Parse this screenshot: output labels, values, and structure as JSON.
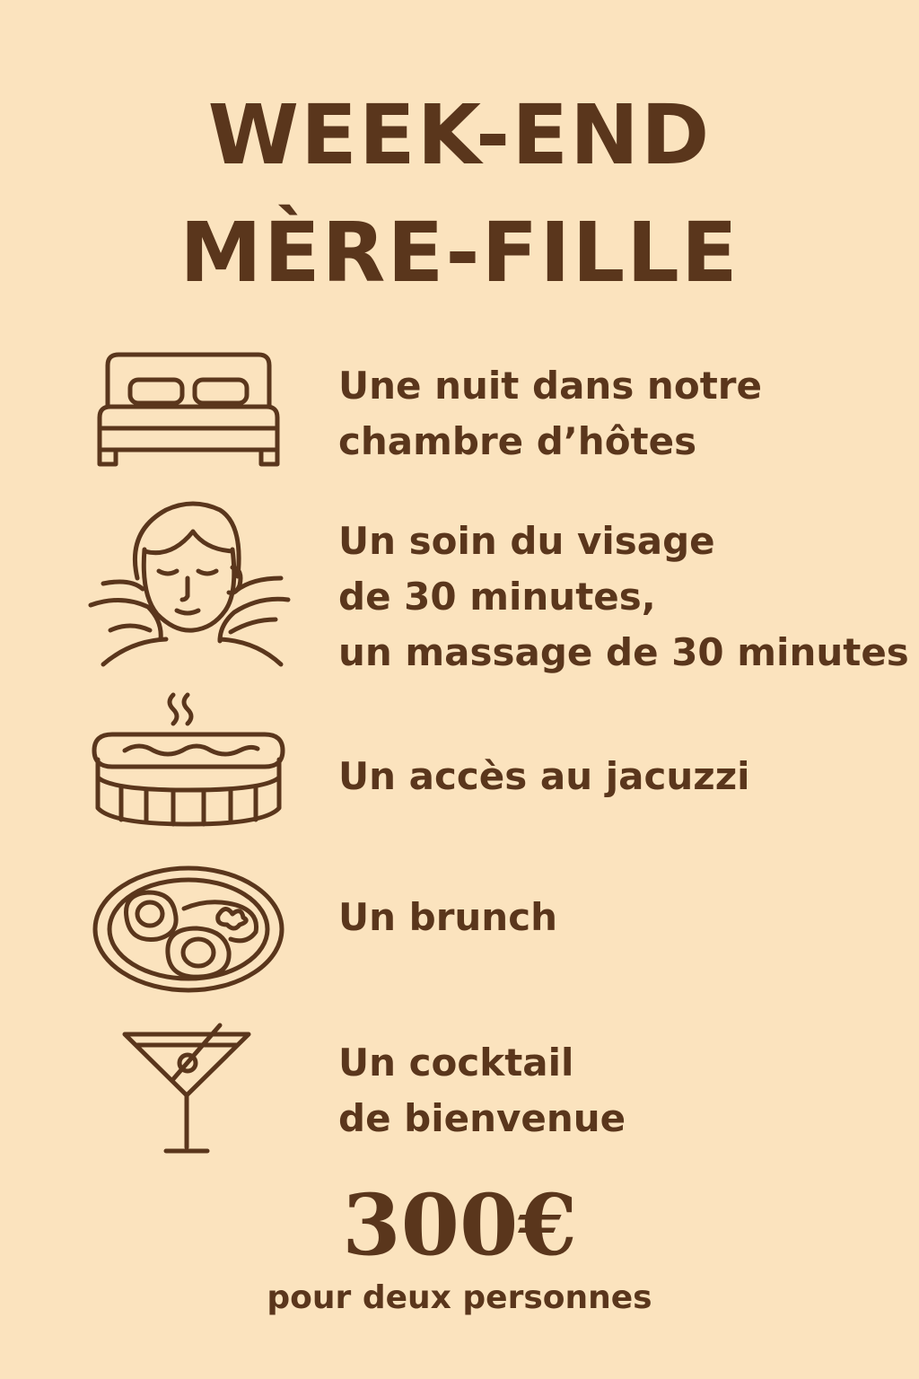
{
  "title": {
    "line1": "WEEK-END",
    "line2": "MÈRE-FILLE"
  },
  "items": [
    {
      "icon": "bed-icon",
      "lines": [
        "Une nuit dans notre",
        "chambre d’hôtes"
      ]
    },
    {
      "icon": "face-massage-icon",
      "lines": [
        "Un soin du visage",
        "de 30 minutes,",
        "un massage de 30 minutes"
      ]
    },
    {
      "icon": "jacuzzi-icon",
      "lines": [
        "Un accès au jacuzzi"
      ]
    },
    {
      "icon": "brunch-plate-icon",
      "lines": [
        "Un brunch"
      ]
    },
    {
      "icon": "cocktail-icon",
      "lines": [
        "Un cocktail",
        "de bienvenue"
      ]
    }
  ],
  "price": {
    "amount": "300€",
    "note": "pour deux personnes"
  },
  "colors": {
    "background": "#fbe3be",
    "text": "#5a361c"
  }
}
